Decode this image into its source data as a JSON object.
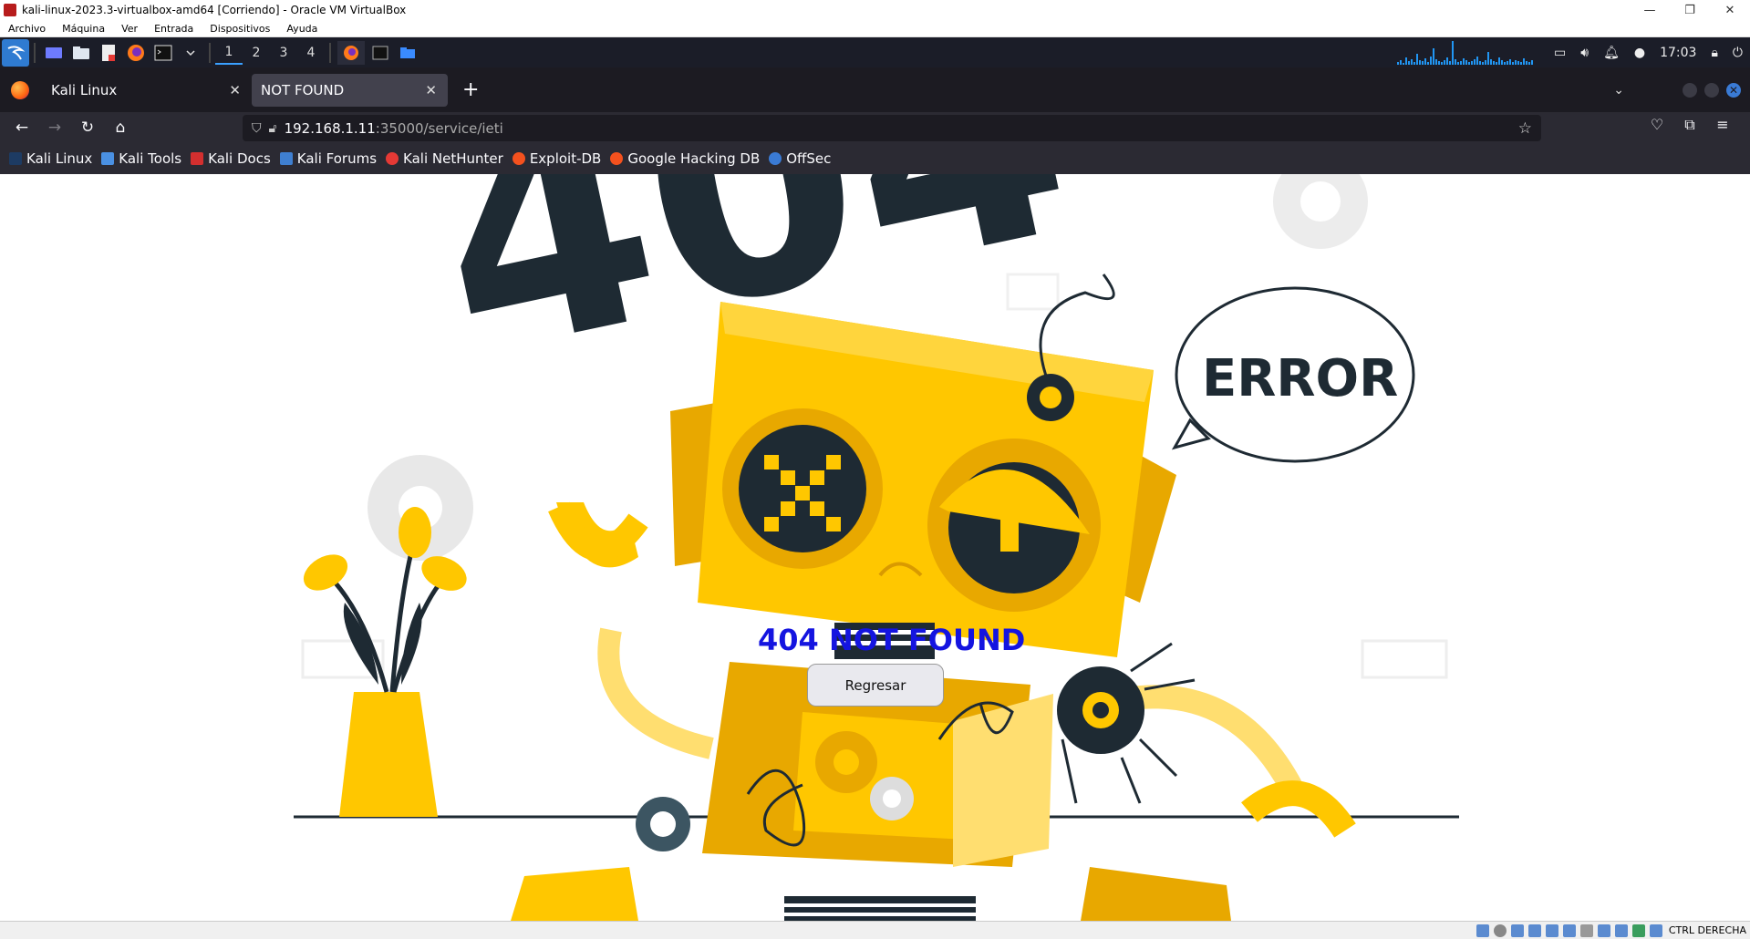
{
  "vbox": {
    "title": "kali-linux-2023.3-virtualbox-amd64 [Corriendo] - Oracle VM VirtualBox",
    "window_controls": [
      "—",
      "❐",
      "✕"
    ],
    "menu": [
      "Archivo",
      "Máquina",
      "Ver",
      "Entrada",
      "Dispositivos",
      "Ayuda"
    ],
    "status_host_key": "CTRL DERECHA"
  },
  "kali_panel": {
    "workspaces": [
      "1",
      "2",
      "3",
      "4"
    ],
    "active_workspace": "1",
    "clock": "17:03",
    "accent": "#2196f3"
  },
  "firefox": {
    "tabs": [
      {
        "label": "Kali Linux",
        "active": false
      },
      {
        "label": "NOT FOUND",
        "active": true
      }
    ],
    "new_tab": "+",
    "url_host": "192.168.1.11",
    "url_rest": ":35000/service/ieti",
    "bookmarks": [
      "Kali Linux",
      "Kali Tools",
      "Kali Docs",
      "Kali Forums",
      "Kali NetHunter",
      "Exploit-DB",
      "Google Hacking DB",
      "OffSec"
    ]
  },
  "page": {
    "heading": "404 NOT FOUND",
    "button": "Regresar",
    "art_big_number": "404",
    "art_bubble_text": "ERROR",
    "heading_color": "#1414e0",
    "robot_color": "#ffc700",
    "dark_color": "#1e2a33"
  }
}
